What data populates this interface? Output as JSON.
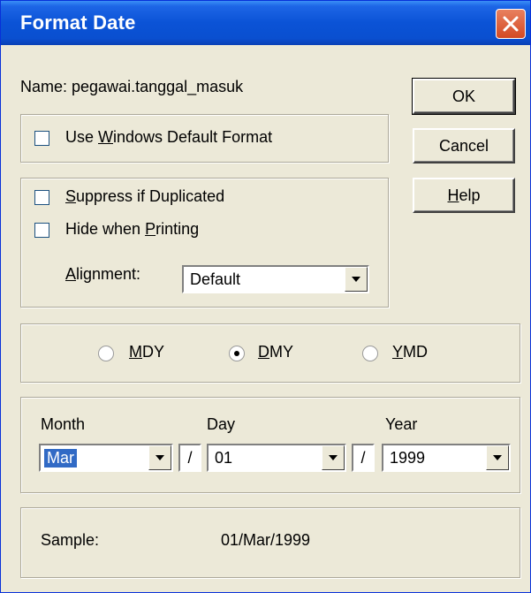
{
  "window": {
    "title": "Format Date"
  },
  "name_label": "Name: pegawai.tanggal_masuk",
  "buttons": {
    "ok": "OK",
    "cancel": "Cancel",
    "help_pre": "",
    "help_u": "H",
    "help_post": "elp"
  },
  "windows_default": {
    "pre": "Use ",
    "u": "W",
    "post": "indows Default Format",
    "checked": false
  },
  "options": {
    "suppress": {
      "pre": "",
      "u": "S",
      "post": "uppress if Duplicated",
      "checked": false
    },
    "hide": {
      "pre": "Hide when ",
      "u": "P",
      "post": "rinting",
      "checked": false
    },
    "alignment": {
      "pre": "",
      "u": "A",
      "post": "lignment:",
      "value": "Default"
    }
  },
  "order": {
    "mdy": {
      "u": "M",
      "post": "DY",
      "selected": false
    },
    "dmy": {
      "u": "D",
      "post": "MY",
      "selected": true
    },
    "ymd": {
      "u": "Y",
      "post": "MD",
      "selected": false
    }
  },
  "date_fields": {
    "month_label": "Month",
    "month_value": "Mar",
    "sep1": "/",
    "day_label": "Day",
    "day_value": "01",
    "sep2": "/",
    "year_label": "Year",
    "year_value": "1999"
  },
  "sample": {
    "label": "Sample:",
    "value": "01/Mar/1999"
  },
  "colors": {
    "titlebar": "#0a4fd0",
    "dialog_bg": "#ece9d8",
    "selection": "#316ac5",
    "close": "#d44a24"
  }
}
